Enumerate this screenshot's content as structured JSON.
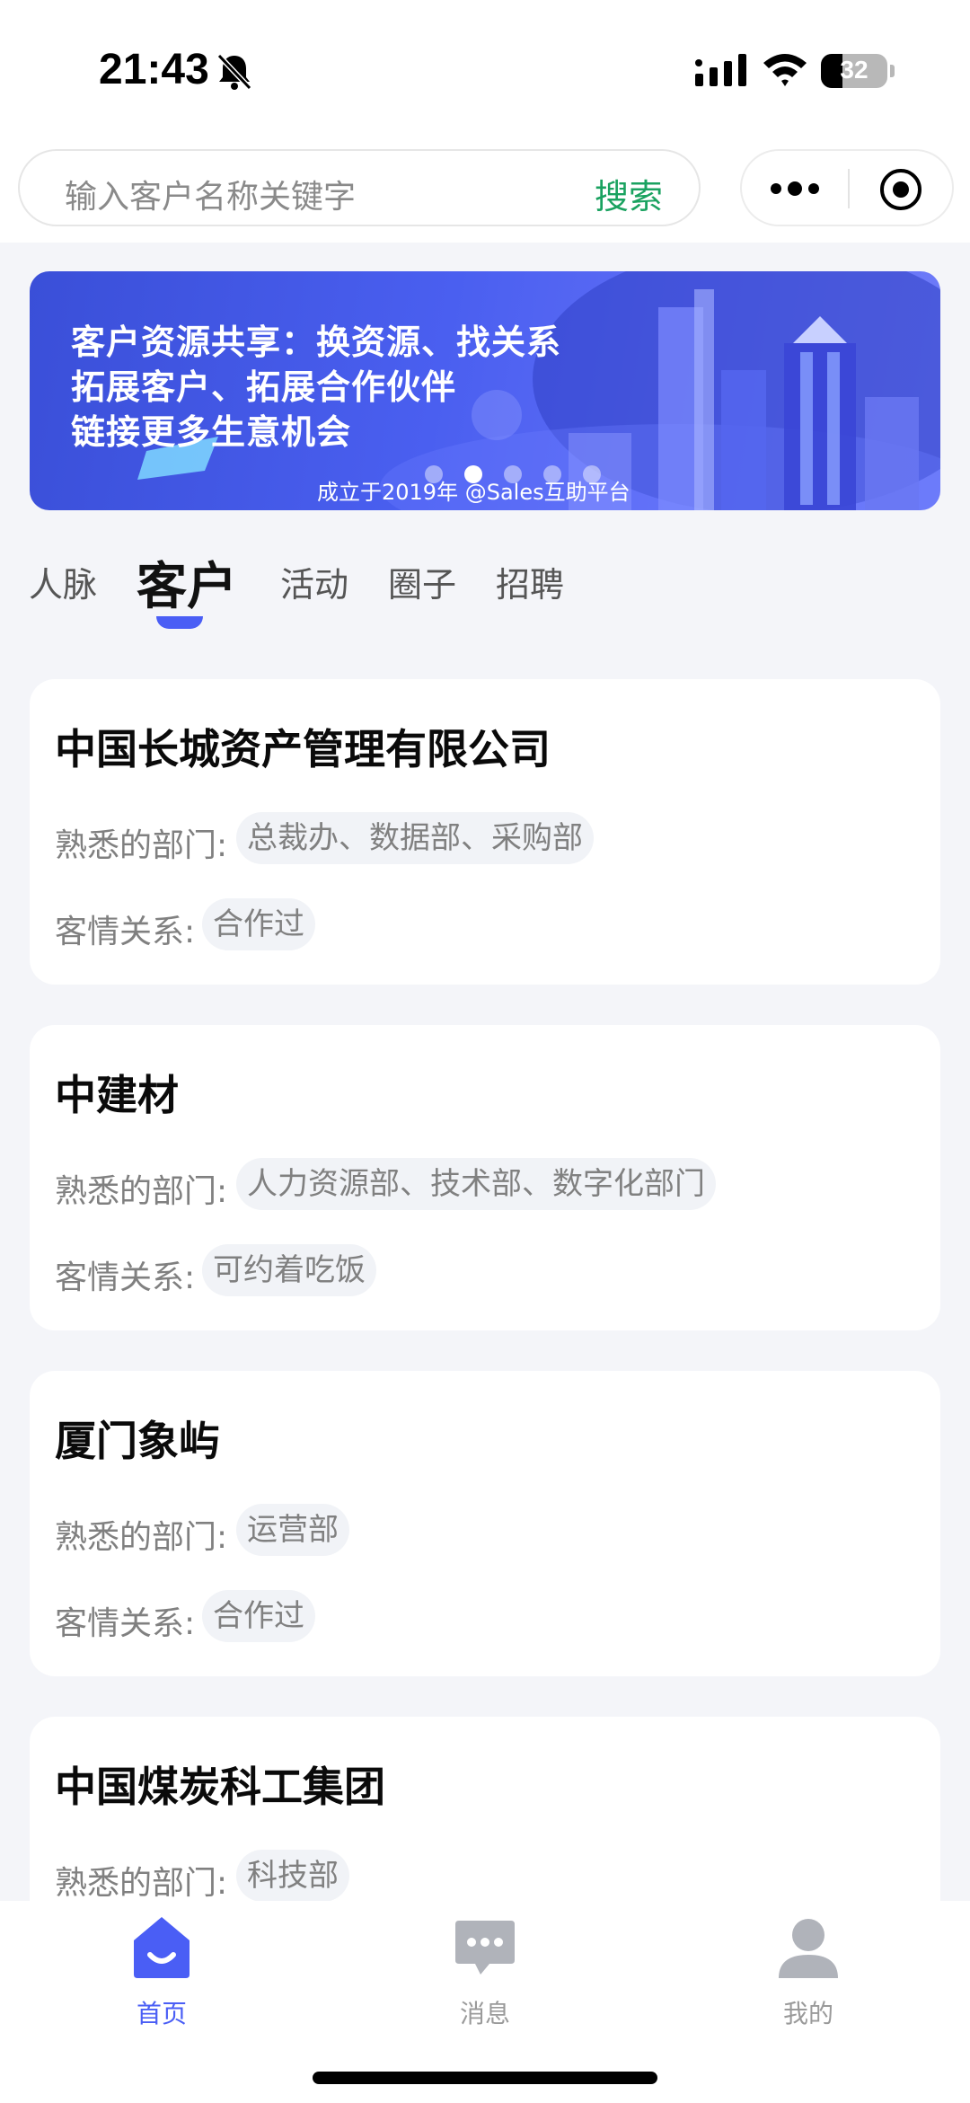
{
  "status_bar": {
    "time": "21:43",
    "battery": "32",
    "icons": [
      "bell-muted-icon",
      "cellular-signal-icon",
      "wifi-icon",
      "battery-icon"
    ]
  },
  "search": {
    "placeholder": "输入客户名称关键字",
    "button": "搜索"
  },
  "capsule": {
    "icons": [
      "more-icon",
      "target-icon"
    ]
  },
  "banner": {
    "lines": [
      "客户资源共享：换资源、找关系",
      "拓展客户、拓展合作伙伴",
      "链接更多生意机会"
    ],
    "footer": "成立于2019年 @Sales互助平台",
    "slide_count": 5,
    "active_slide": 2
  },
  "tabs": [
    {
      "label": "人脉",
      "active": false
    },
    {
      "label": "客户",
      "active": true
    },
    {
      "label": "活动",
      "active": false
    },
    {
      "label": "圈子",
      "active": false
    },
    {
      "label": "招聘",
      "active": false
    }
  ],
  "cards": [
    {
      "name": "中国长城资产管理有限公司",
      "dept_label": "熟悉的部门:",
      "dept": "总裁办、数据部、采购部",
      "rel_label": "客情关系:",
      "rel": "合作过"
    },
    {
      "name": "中建材",
      "dept_label": "熟悉的部门:",
      "dept": "人力资源部、技术部、数字化部门",
      "rel_label": "客情关系:",
      "rel": "可约着吃饭"
    },
    {
      "name": "厦门象屿",
      "dept_label": "熟悉的部门:",
      "dept": "运营部",
      "rel_label": "客情关系:",
      "rel": "合作过"
    },
    {
      "name": "中国煤炭科工集团",
      "dept_label": "熟悉的部门:",
      "dept": "科技部"
    }
  ],
  "nav": [
    {
      "label": "首页",
      "icon": "home-icon",
      "active": true
    },
    {
      "label": "消息",
      "icon": "message-icon",
      "active": false
    },
    {
      "label": "我的",
      "icon": "profile-icon",
      "active": false
    }
  ],
  "colors": {
    "accent": "#4a5ef5",
    "search_button": "#1aa260",
    "chip_bg": "#f1f3f7",
    "page_bg": "#f4f5f9"
  }
}
